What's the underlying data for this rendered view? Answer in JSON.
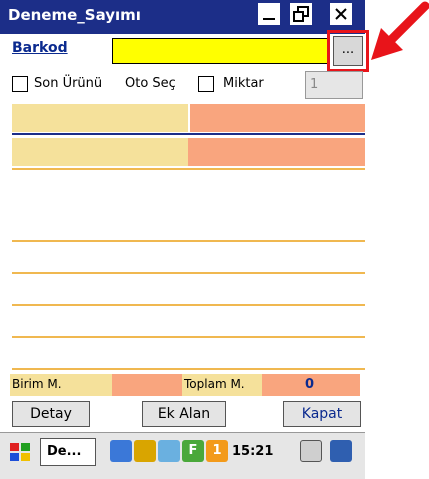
{
  "window": {
    "title": "Deneme_Sayımı"
  },
  "titlebar_buttons": {
    "minimize": "_",
    "restore": "❐",
    "close": "×"
  },
  "form": {
    "barkod_label": "Barkod",
    "barkod_value": "",
    "browse_label": "...",
    "son_urunu_label": "Son Ürünü",
    "oto_sec_label": "Oto Seç",
    "miktar_label": "Miktar",
    "miktar_value": "1"
  },
  "summary": {
    "birim_label": "Birim M.",
    "toplam_label": "Toplam M.",
    "toplam_value": "0"
  },
  "buttons": {
    "detay": "Detay",
    "ek_alan": "Ek Alan",
    "kapat": "Kapat"
  },
  "taskbar": {
    "task_label": "De...",
    "time": "15:21"
  },
  "colors": {
    "title_bg": "#1c2e88",
    "input_bg": "#ffff00",
    "cell_yellow": "#f5e19b",
    "cell_orange": "#f9a57e",
    "highlight": "#e8141a"
  }
}
